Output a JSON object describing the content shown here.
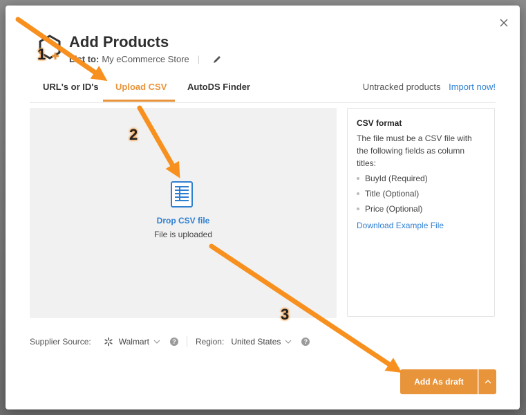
{
  "dialog": {
    "title": "Add Products",
    "list_label": "List to:",
    "store_name": "My eCommerce Store",
    "separator": "|"
  },
  "tabs": [
    {
      "label": "URL's or ID's"
    },
    {
      "label": "Upload CSV",
      "active": true
    },
    {
      "label": "AutoDS Finder"
    }
  ],
  "untracked": {
    "text": "Untracked products",
    "link": "Import now!"
  },
  "dropzone": {
    "label": "Drop CSV file",
    "status": "File is uploaded"
  },
  "csv_info": {
    "heading": "CSV format",
    "description": "The file must be a CSV file with the following fields as column titles:",
    "fields": [
      "BuyId (Required)",
      "Title (Optional)",
      "Price (Optional)"
    ],
    "download_link": "Download Example File"
  },
  "supplier": {
    "label": "Supplier Source:",
    "value": "Walmart"
  },
  "region": {
    "label": "Region:",
    "value": "United States"
  },
  "help_glyph": "?",
  "buttons": {
    "add_draft": "Add As draft"
  },
  "annotations": {
    "step1": "1",
    "step2": "2",
    "step3": "3"
  },
  "colors": {
    "accent": "#e8943a",
    "link": "#2f7fd1",
    "annotation": "#f7901e"
  },
  "icons": [
    "close-icon",
    "product-add-icon",
    "pencil-icon",
    "csv-file-icon",
    "walmart-spark-icon",
    "chevron-down-icon",
    "help-icon",
    "chevron-up-icon"
  ]
}
